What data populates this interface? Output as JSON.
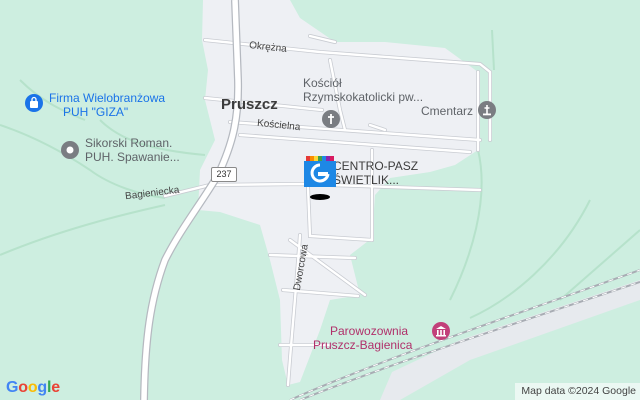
{
  "map": {
    "town_label": "Pruszcz",
    "streets": {
      "okrezna": "Okrężna",
      "koscielna": "Kościelna",
      "bagieniecka": "Bagieniecka",
      "dworcowa": "Dworcowa"
    },
    "road_number": "237",
    "pois": [
      {
        "line1": "Firma Wielobranżowa",
        "line2": "PUH \"GIZA\"",
        "icon": "shopping-bag-icon",
        "color": "#1a73e8"
      },
      {
        "line1": "Sikorski Roman.",
        "line2": "PUH. Spawanie...",
        "icon": "place-icon",
        "color": "#5f6368"
      },
      {
        "line1": "Kościół",
        "line2": "Rzymskokatolicki pw...",
        "icon": "church-icon",
        "color": "#5f6368"
      },
      {
        "line1": "Cmentarz",
        "line2": "",
        "icon": "cemetery-icon",
        "color": "#5f6368"
      },
      {
        "line1": "CENTRO-PASZ",
        "line2": "ŚWIETLIK...",
        "icon": "business-marker-icon",
        "color": "#3c3c3c"
      },
      {
        "line1": "Parowozownia",
        "line2": "Pruszcz-Bagienica",
        "icon": "museum-icon",
        "color": "#b0306a"
      }
    ]
  },
  "footer": {
    "logo": "Google",
    "attribution": "Map data ©2024 Google"
  },
  "colors": {
    "land": "#cdeee0",
    "town_area": "#eef0f4",
    "road": "#ffffff",
    "road_border": "#c9ccd2",
    "poi_blue": "#1a73e8",
    "poi_gray": "#5f6368",
    "poi_pink": "#b0306a"
  }
}
